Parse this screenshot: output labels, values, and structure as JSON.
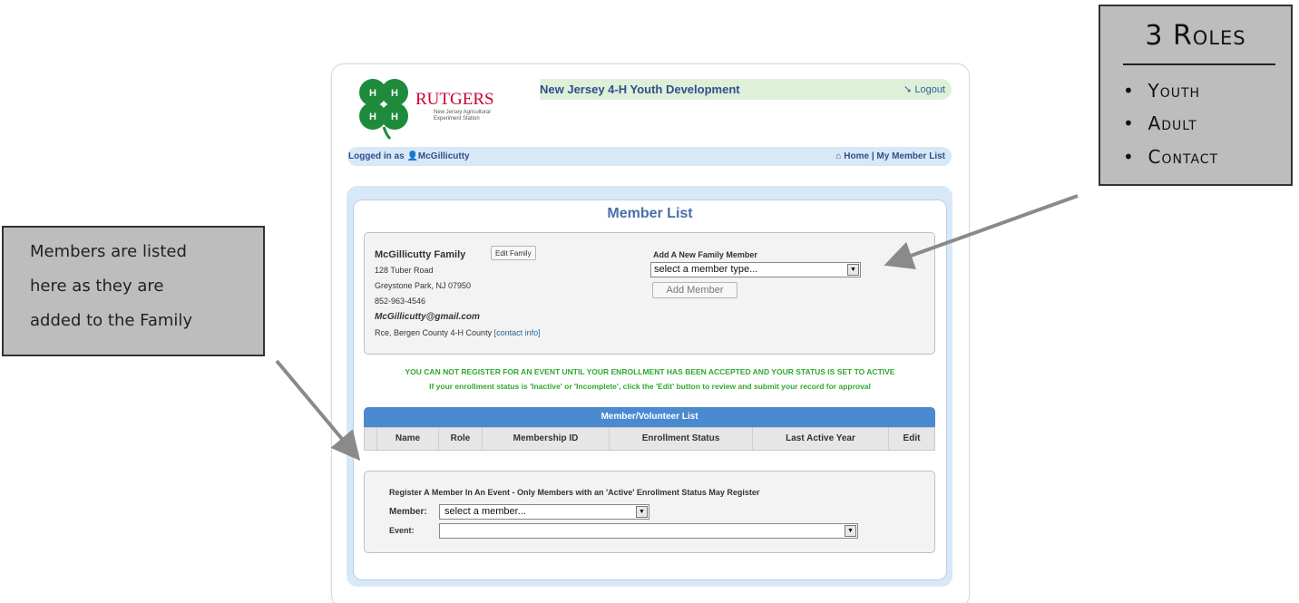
{
  "header": {
    "org_name": "RUTGERS",
    "org_sub1": "New Jersey Agricultural",
    "org_sub2": "Experiment Station",
    "site_title": "New Jersey 4-H Youth Development",
    "logout_label": "Logout"
  },
  "nav": {
    "logged_in_prefix": "Logged in as",
    "username": "McGillicutty",
    "home_label": "Home",
    "separator": "|",
    "my_member_list_label": "My Member List"
  },
  "page": {
    "title": "Member List"
  },
  "family": {
    "name": "McGillicutty Family",
    "edit_label": "Edit Family",
    "address1": "128 Tuber Road",
    "address2": "Greystone Park, NJ 07950",
    "phone": "852-963-4546",
    "email": "McGillicutty@gmail.com",
    "county": "Rce, Bergen County 4-H County",
    "contact_link": "[contact info]"
  },
  "add_member": {
    "heading": "Add A New Family Member",
    "select_value": "select a member type...",
    "button_label": "Add Member"
  },
  "notices": {
    "line1": "YOU CAN NOT REGISTER FOR AN EVENT UNTIL YOUR ENROLLMENT HAS BEEN ACCEPTED AND YOUR STATUS IS SET TO ACTIVE",
    "line2": "If your enrollment status is 'Inactive' or 'Incomplete', click the 'Edit' button to review and submit your record for approval"
  },
  "member_table": {
    "title": "Member/Volunteer List",
    "columns": [
      "Name",
      "Role",
      "Membership ID",
      "Enrollment Status",
      "Last Active Year",
      "Edit"
    ]
  },
  "register": {
    "heading": "Register A Member In An Event - Only Members with an 'Active' Enrollment Status May Register",
    "member_label": "Member:",
    "member_select_value": "select a member...",
    "event_label": "Event:",
    "event_select_value": ""
  },
  "annotations": {
    "roles_title": "3 Roles",
    "roles": [
      "Youth",
      "Adult",
      "Contact"
    ],
    "members_note": [
      "Members are listed",
      "here as they are",
      "added to the Family"
    ]
  },
  "colors": {
    "clover_green": "#1e8a3c",
    "rutgers_red": "#cc0033",
    "accent_blue": "#4a8ad0",
    "notice_green": "#2fa82f"
  }
}
